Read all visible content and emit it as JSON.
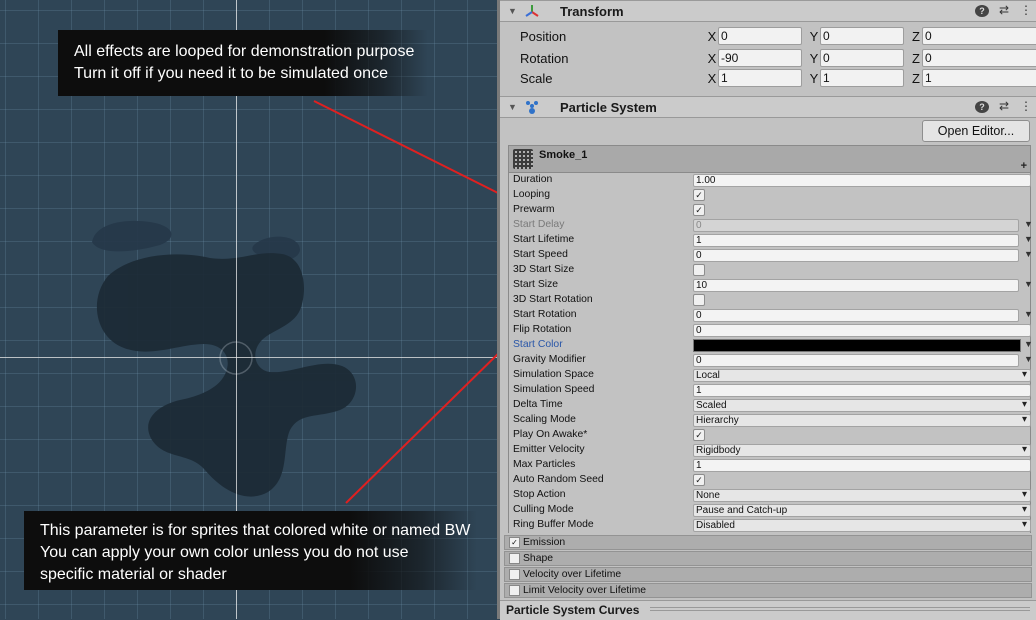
{
  "scene": {
    "callout_top": [
      "All effects are looped for demonstration purpose",
      "Turn it off if you need it to be simulated once"
    ],
    "callout_bottom": [
      "This parameter is for sprites that colored white or named BW",
      "You can apply your own color unless you do not use",
      "specific material or shader"
    ],
    "annotation_line_color": "#e02020"
  },
  "transform": {
    "title": "Transform",
    "icon": "transform-axes-icon",
    "rows": [
      {
        "label": "Position",
        "x": "0",
        "y": "0",
        "z": "0"
      },
      {
        "label": "Rotation",
        "x": "-90",
        "y": "0",
        "z": "0"
      },
      {
        "label": "Scale",
        "x": "1",
        "y": "1",
        "z": "1"
      }
    ],
    "axis_x": "X",
    "axis_y": "Y",
    "axis_z": "Z"
  },
  "particle_system": {
    "title": "Particle System",
    "icon": "particle-system-icon",
    "open_editor": "Open Editor...",
    "module_name": "Smoke_1",
    "plus": "+",
    "props": [
      {
        "label": "Duration",
        "type": "input",
        "value": "1.00"
      },
      {
        "label": "Looping",
        "type": "check",
        "value": "✓"
      },
      {
        "label": "Prewarm",
        "type": "check",
        "value": "✓"
      },
      {
        "label": "Start Delay",
        "type": "input-dis",
        "value": "0"
      },
      {
        "label": "Start Lifetime",
        "type": "input-arrow",
        "value": "1"
      },
      {
        "label": "Start Speed",
        "type": "input-arrow",
        "value": "0"
      },
      {
        "label": "3D Start Size",
        "type": "check",
        "value": ""
      },
      {
        "label": "Start Size",
        "type": "input-arrow",
        "value": "10"
      },
      {
        "label": "3D Start Rotation",
        "type": "check",
        "value": ""
      },
      {
        "label": "Start Rotation",
        "type": "input-arrow",
        "value": "0"
      },
      {
        "label": "Flip Rotation",
        "type": "input",
        "value": "0"
      },
      {
        "label": "Start Color",
        "type": "color",
        "value": ""
      },
      {
        "label": "Gravity Modifier",
        "type": "input-arrow",
        "value": "0"
      },
      {
        "label": "Simulation Space",
        "type": "drop",
        "value": "Local"
      },
      {
        "label": "Simulation Speed",
        "type": "input",
        "value": "1"
      },
      {
        "label": "Delta Time",
        "type": "drop",
        "value": "Scaled"
      },
      {
        "label": "Scaling Mode",
        "type": "drop",
        "value": "Hierarchy"
      },
      {
        "label": "Play On Awake*",
        "type": "check",
        "value": "✓"
      },
      {
        "label": "Emitter Velocity",
        "type": "drop",
        "value": "Rigidbody"
      },
      {
        "label": "Max Particles",
        "type": "input",
        "value": "1"
      },
      {
        "label": "Auto Random Seed",
        "type": "check",
        "value": "✓"
      },
      {
        "label": "Stop Action",
        "type": "drop",
        "value": "None"
      },
      {
        "label": "Culling Mode",
        "type": "drop",
        "value": "Pause and Catch-up"
      },
      {
        "label": "Ring Buffer Mode",
        "type": "drop",
        "value": "Disabled"
      }
    ],
    "start_color_value": "#000000",
    "modules": [
      {
        "label": "Emission",
        "checked": "✓"
      },
      {
        "label": "Shape",
        "checked": ""
      },
      {
        "label": "Velocity over Lifetime",
        "checked": ""
      },
      {
        "label": "Limit Velocity over Lifetime",
        "checked": ""
      }
    ]
  },
  "curves": {
    "title": "Particle System Curves"
  }
}
